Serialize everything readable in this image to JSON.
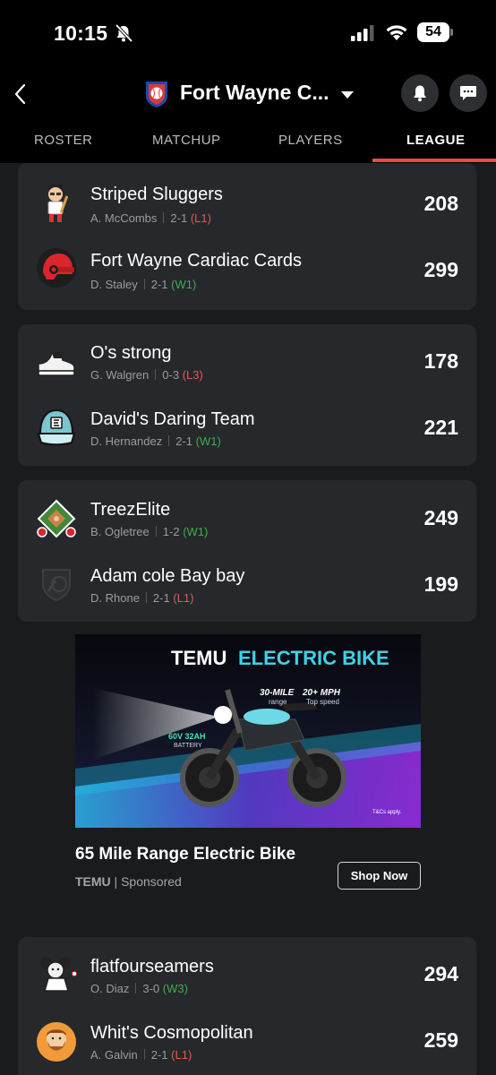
{
  "status": {
    "time": "10:15",
    "battery": "54"
  },
  "header": {
    "title": "Fort Wayne C...",
    "tabs": [
      "ROSTER",
      "MATCHUP",
      "PLAYERS",
      "LEAGUE"
    ],
    "active_tab": "LEAGUE"
  },
  "matchups": [
    {
      "teams": [
        {
          "name": "Striped Sluggers",
          "owner": "A. McCombs",
          "record": "2-1",
          "streak": "(L1)",
          "streak_type": "L",
          "score": "208",
          "avatar": "cartoon-player-icon"
        },
        {
          "name": "Fort Wayne Cardiac Cards",
          "owner": "D. Staley",
          "record": "2-1",
          "streak": "(W1)",
          "streak_type": "W",
          "score": "299",
          "avatar": "red-helmet-icon"
        }
      ]
    },
    {
      "teams": [
        {
          "name": "O's strong",
          "owner": "G. Walgren",
          "record": "0-3",
          "streak": "(L3)",
          "streak_type": "L",
          "score": "178",
          "avatar": "sneaker-icon"
        },
        {
          "name": "David's Daring Team",
          "owner": "D. Hernandez",
          "record": "2-1",
          "streak": "(W1)",
          "streak_type": "W",
          "score": "221",
          "avatar": "cap-icon"
        }
      ]
    },
    {
      "teams": [
        {
          "name": "TreezElite",
          "owner": "B. Ogletree",
          "record": "1-2",
          "streak": "(W1)",
          "streak_type": "W",
          "score": "249",
          "avatar": "baseball-field-icon"
        },
        {
          "name": "Adam cole Bay bay",
          "owner": "D. Rhone",
          "record": "2-1",
          "streak": "(L1)",
          "streak_type": "L",
          "score": "199",
          "avatar": "shield-icon"
        }
      ]
    },
    {
      "teams": [
        {
          "name": "flatfourseamers",
          "owner": "O. Diaz",
          "record": "3-0",
          "streak": "(W3)",
          "streak_type": "W",
          "score": "294",
          "avatar": "mouse-pitcher-icon"
        },
        {
          "name": "Whit's Cosmopolitan",
          "owner": "A. Galvin",
          "record": "2-1",
          "streak": "(L1)",
          "streak_type": "L",
          "score": "259",
          "avatar": "bearded-man-icon"
        }
      ]
    }
  ],
  "ad": {
    "image_title_a": "TEMU",
    "image_title_b": "ELECTRIC BIKE",
    "range": "30-MILE",
    "range_sub": "range",
    "speed": "20+ MPH",
    "speed_sub": "Top speed",
    "battery": "60V 32AH",
    "battery_sub": "BATTERY",
    "fine_print": "T&Cs apply.",
    "headline": "65 Mile Range Electric Bike",
    "brand": "TEMU",
    "sponsored": "Sponsored",
    "cta": "Shop Now"
  },
  "colors": {
    "accent": "#e94b4b",
    "loss": "#e05b56",
    "win": "#3fae4e",
    "card": "#26282b",
    "background": "#1a1b1d"
  }
}
